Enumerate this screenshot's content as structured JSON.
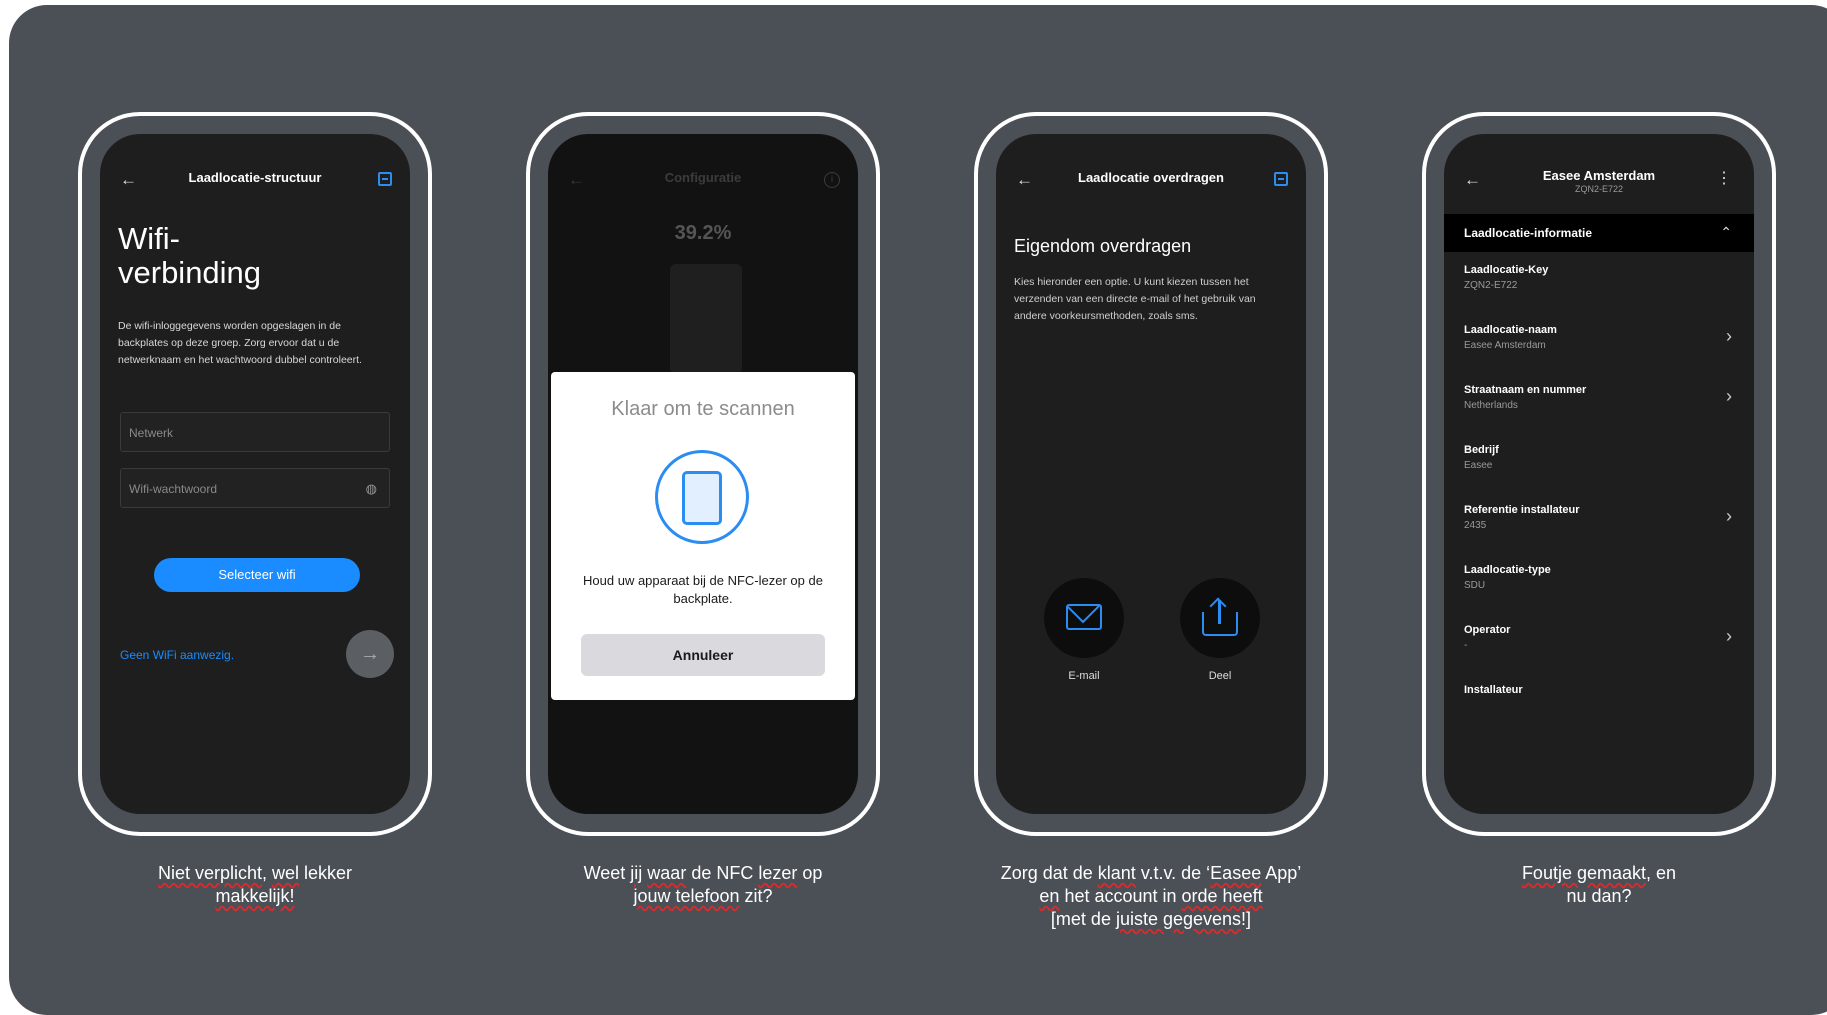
{
  "phone1": {
    "header_title": "Laadlocatie-structuur",
    "heading": "Wifi-\nverbinding",
    "description": "De wifi-inloggegevens worden opgeslagen in de backplates op deze groep. Zorg ervoor dat u de netwerknaam en het wachtwoord dubbel controleert.",
    "network_placeholder": "Netwerk",
    "password_placeholder": "Wifi-wachtwoord",
    "select_button": "Selecteer wifi",
    "no_wifi_link": "Geen WiFi aanwezig.",
    "caption_line1_a": "Niet verplicht",
    "caption_line1_b": ", ",
    "caption_line1_c": "wel",
    "caption_line1_d": " lekker",
    "caption_line2": "makkelijk!"
  },
  "phone2": {
    "header_title": "Configuratie",
    "progress": "39.2%",
    "dialog_title": "Klaar om te scannen",
    "dialog_text": "Houd uw apparaat bij de NFC-lezer op de backplate.",
    "cancel_button": "Annuleer",
    "caption_line1_a": "Weet ",
    "caption_line1_b": "jij",
    "caption_line1_c": " ",
    "caption_line1_d": "waar",
    "caption_line1_e": " de NFC ",
    "caption_line1_f": "lezer",
    "caption_line1_g": " op",
    "caption_line2_a": "jouw telefoon",
    "caption_line2_b": " zit?"
  },
  "phone3": {
    "header_title": "Laadlocatie overdragen",
    "heading": "Eigendom overdragen",
    "description": "Kies hieronder een optie. U kunt kiezen tussen het verzenden van een directe e-mail of het gebruik van andere voorkeursmethoden, zoals sms.",
    "email_label": "E-mail",
    "share_label": "Deel",
    "caption_line1_a": "Zorg dat de ",
    "caption_line1_b": "klant",
    "caption_line1_c": " v.t.v. de ‘",
    "caption_line1_d": "Easee",
    "caption_line1_e": " App’",
    "caption_line2_a": "en",
    "caption_line2_b": " het account in ",
    "caption_line2_c": "orde heeft",
    "caption_line3_a": "[met de ",
    "caption_line3_b": "juiste gegevens",
    "caption_line3_c": "!]"
  },
  "phone4": {
    "header_title": "Easee Amsterdam",
    "header_subtitle": "ZQN2-E722",
    "section_title": "Laadlocatie-informatie",
    "rows": [
      {
        "label": "Laadlocatie-Key",
        "value": "ZQN2-E722",
        "chevron": false
      },
      {
        "label": "Laadlocatie-naam",
        "value": "Easee Amsterdam",
        "chevron": true
      },
      {
        "label": "Straatnaam en nummer",
        "value": "Netherlands",
        "chevron": true
      },
      {
        "label": "Bedrijf",
        "value": "Easee",
        "chevron": false
      },
      {
        "label": "Referentie installateur",
        "value": "2435",
        "chevron": true
      },
      {
        "label": "Laadlocatie-type",
        "value": "SDU",
        "chevron": false
      },
      {
        "label": "Operator",
        "value": "-",
        "chevron": true
      },
      {
        "label": "Installateur",
        "value": "",
        "chevron": false
      }
    ],
    "caption_line1_a": "Foutje gemaakt",
    "caption_line1_b": ", en",
    "caption_line2": "nu dan?"
  },
  "colors": {
    "background": "#4b4f56",
    "screen": "#1e1e1e",
    "accent": "#1a8cff",
    "dialog_icon": "#2b8cf2"
  }
}
